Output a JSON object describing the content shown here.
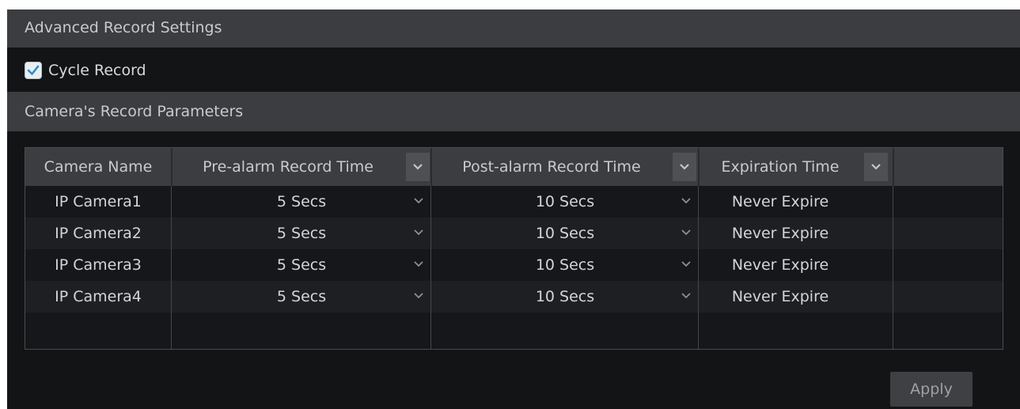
{
  "sections": {
    "advanced_title": "Advanced Record Settings",
    "params_title": "Camera's Record Parameters"
  },
  "cycle_record": {
    "label": "Cycle Record",
    "checked": true
  },
  "table": {
    "headers": {
      "camera_name": "Camera Name",
      "pre_alarm": "Pre-alarm Record Time",
      "post_alarm": "Post-alarm Record Time",
      "expiration": "Expiration Time"
    },
    "rows": [
      {
        "camera": "IP Camera1",
        "pre": "5 Secs",
        "post": "10 Secs",
        "expire": "Never Expire"
      },
      {
        "camera": "IP Camera2",
        "pre": "5 Secs",
        "post": "10 Secs",
        "expire": "Never Expire"
      },
      {
        "camera": "IP Camera3",
        "pre": "5 Secs",
        "post": "10 Secs",
        "expire": "Never Expire"
      },
      {
        "camera": "IP Camera4",
        "pre": "5 Secs",
        "post": "10 Secs",
        "expire": "Never Expire"
      }
    ]
  },
  "apply_label": "Apply",
  "icons": {
    "dropdown": "chevron-down-icon",
    "check": "check-icon"
  },
  "colors": {
    "panel_bg": "#131416",
    "header_bg": "#3b3d40",
    "checkbox_accent": "#2a8fc7"
  }
}
